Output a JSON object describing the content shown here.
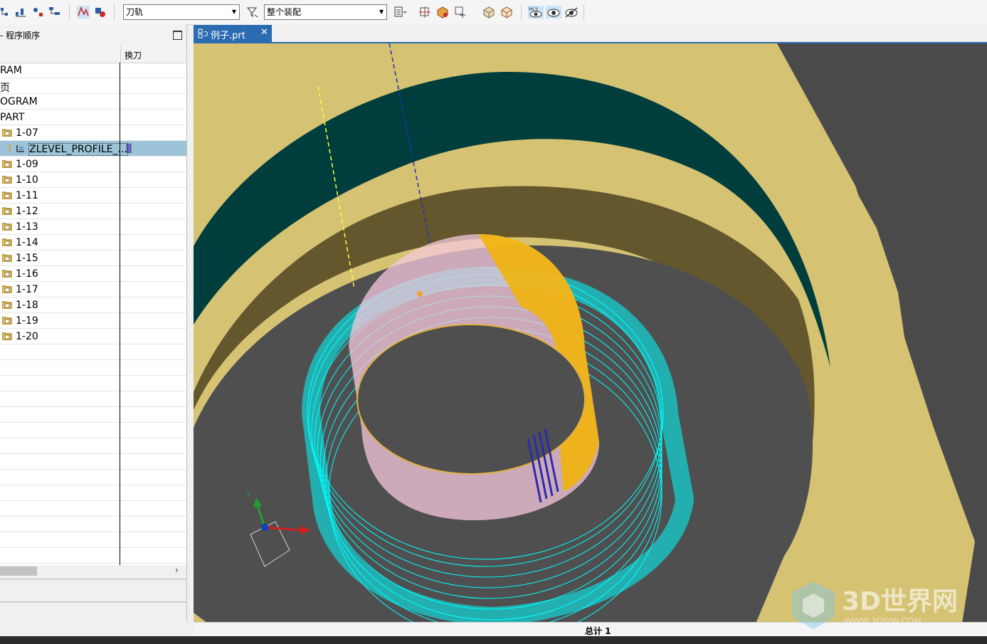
{
  "toolbar": {
    "filter_combo": "刀轨",
    "scope_combo": "整个装配",
    "mcs_label": "MCS"
  },
  "navigator": {
    "title": "- 程序顺序",
    "column_change": "换刀",
    "rows": [
      {
        "label": "RAM",
        "folder": false,
        "selected": false
      },
      {
        "label": "页",
        "folder": false,
        "selected": false
      },
      {
        "label": "OGRAM",
        "folder": false,
        "selected": false
      },
      {
        "label": "PART",
        "folder": false,
        "selected": false
      },
      {
        "label": "1-07",
        "folder": true,
        "selected": false
      },
      {
        "label": "ZLEVEL_PROFILE_...",
        "folder": false,
        "selected": true,
        "operation": true
      },
      {
        "label": "1-09",
        "folder": true,
        "selected": false
      },
      {
        "label": "1-10",
        "folder": true,
        "selected": false
      },
      {
        "label": "1-11",
        "folder": true,
        "selected": false
      },
      {
        "label": "1-12",
        "folder": true,
        "selected": false
      },
      {
        "label": "1-13",
        "folder": true,
        "selected": false
      },
      {
        "label": "1-14",
        "folder": true,
        "selected": false
      },
      {
        "label": "1-15",
        "folder": true,
        "selected": false
      },
      {
        "label": "1-16",
        "folder": true,
        "selected": false
      },
      {
        "label": "1-17",
        "folder": true,
        "selected": false
      },
      {
        "label": "1-18",
        "folder": true,
        "selected": false
      },
      {
        "label": "1-19",
        "folder": true,
        "selected": false
      },
      {
        "label": "1-20",
        "folder": true,
        "selected": false
      },
      {
        "label": "",
        "folder": false,
        "selected": false
      },
      {
        "label": "",
        "folder": false,
        "selected": false
      },
      {
        "label": "",
        "folder": false,
        "selected": false
      },
      {
        "label": "",
        "folder": false,
        "selected": false
      },
      {
        "label": "",
        "folder": false,
        "selected": false
      },
      {
        "label": "",
        "folder": false,
        "selected": false
      },
      {
        "label": "",
        "folder": false,
        "selected": false
      },
      {
        "label": "",
        "folder": false,
        "selected": false
      },
      {
        "label": "",
        "folder": false,
        "selected": false
      },
      {
        "label": "",
        "folder": false,
        "selected": false
      },
      {
        "label": "",
        "folder": false,
        "selected": false
      },
      {
        "label": "",
        "folder": false,
        "selected": false
      },
      {
        "label": "",
        "folder": false,
        "selected": false
      },
      {
        "label": "",
        "folder": false,
        "selected": false
      }
    ]
  },
  "tab": {
    "name": "例子.prt"
  },
  "viewport": {
    "axis_y_label": "Y",
    "colors": {
      "part_face": "#d5c272",
      "dark_ring": "#003e3d",
      "floor": "#4f4f50",
      "outer_toolpath": "#00ffff",
      "inner_toolpath": "#f5c8dc",
      "inner_right": "#f2b400"
    }
  },
  "status": {
    "total": "总计 1"
  },
  "watermark": {
    "brand": "3D世界网",
    "url": "WWW.3DSJW.COM"
  }
}
